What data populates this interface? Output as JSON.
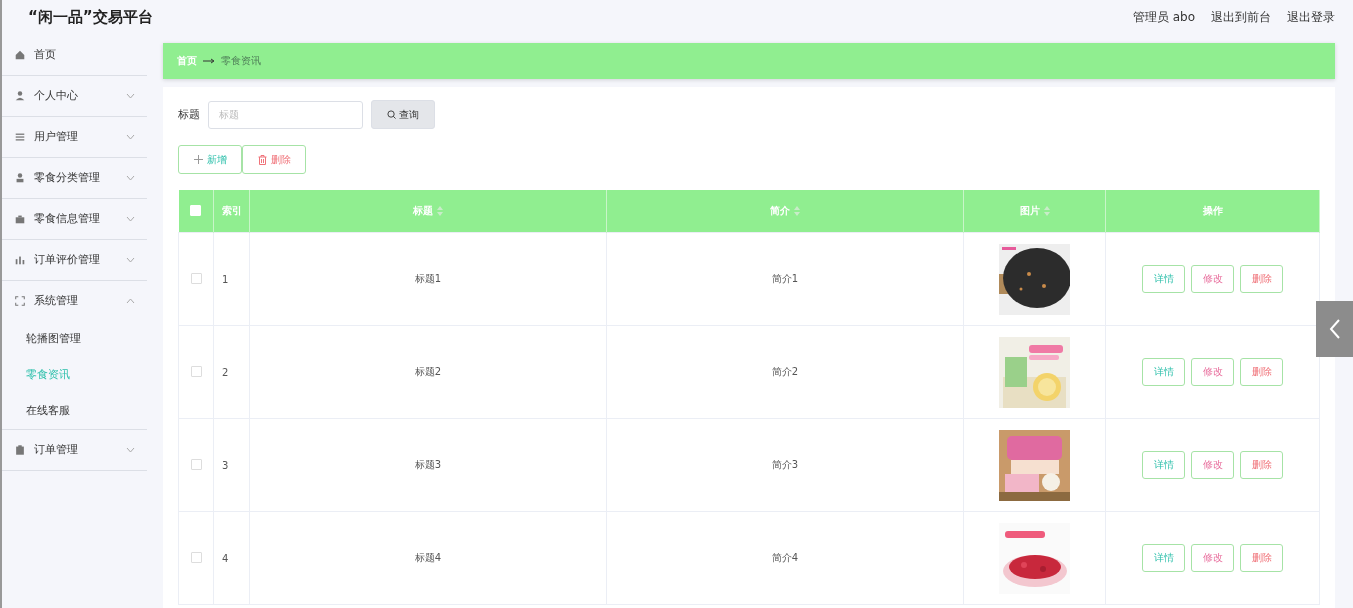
{
  "header": {
    "title": "“闲一品”交易平台",
    "links": [
      "管理员 abo",
      "退出到前台",
      "退出登录"
    ]
  },
  "sidebar": {
    "items": [
      {
        "label": "首页"
      },
      {
        "label": "个人中心",
        "expanded": false
      },
      {
        "label": "用户管理",
        "expanded": false
      },
      {
        "label": "零食分类管理",
        "expanded": false
      },
      {
        "label": "零食信息管理",
        "expanded": false
      },
      {
        "label": "订单评价管理",
        "expanded": false
      },
      {
        "label": "系统管理",
        "expanded": true,
        "children": [
          {
            "label": "轮播图管理",
            "selected": false
          },
          {
            "label": "零食资讯",
            "selected": true
          },
          {
            "label": "在线客服",
            "selected": false
          }
        ]
      },
      {
        "label": "订单管理",
        "expanded": false
      }
    ]
  },
  "breadcrumb": [
    "首页",
    "零食资讯"
  ],
  "search": {
    "label": "标题",
    "placeholder": "标题",
    "button": "查询"
  },
  "actions": [
    {
      "kind": "add",
      "label": "新增"
    },
    {
      "kind": "delete",
      "label": "删除"
    }
  ],
  "table": {
    "select_all_checked": false,
    "columns": [
      {
        "label": "索引",
        "sortable": false
      },
      {
        "label": "标题",
        "sortable": true
      },
      {
        "label": "简介",
        "sortable": true
      },
      {
        "label": "图片",
        "sortable": true
      },
      {
        "label": "操作",
        "sortable": false
      }
    ],
    "rows": [
      {
        "checked": false,
        "index": "1",
        "title": "标题1",
        "intro": "简介1",
        "picture": {
          "kind": "picture"
        },
        "buttons": [
          {
            "kind": "detail",
            "label": "详情"
          },
          {
            "kind": "edit",
            "label": "修改"
          },
          {
            "kind": "delete",
            "label": "删除"
          }
        ]
      },
      {
        "checked": false,
        "index": "2",
        "title": "标题2",
        "intro": "简介2",
        "picture": {
          "kind": "picture"
        },
        "buttons": [
          {
            "kind": "detail",
            "label": "详情"
          },
          {
            "kind": "edit",
            "label": "修改"
          },
          {
            "kind": "delete",
            "label": "删除"
          }
        ]
      },
      {
        "checked": false,
        "index": "3",
        "title": "标题3",
        "intro": "简介3",
        "picture": {
          "kind": "picture"
        },
        "buttons": [
          {
            "kind": "detail",
            "label": "详情"
          },
          {
            "kind": "edit",
            "label": "修改"
          },
          {
            "kind": "delete",
            "label": "删除"
          }
        ]
      },
      {
        "checked": false,
        "index": "4",
        "title": "标题4",
        "intro": "简介4",
        "picture": {
          "kind": "picture"
        },
        "buttons": [
          {
            "kind": "detail",
            "label": "详情"
          },
          {
            "kind": "edit",
            "label": "修改"
          },
          {
            "kind": "delete",
            "label": "删除"
          }
        ]
      }
    ]
  }
}
